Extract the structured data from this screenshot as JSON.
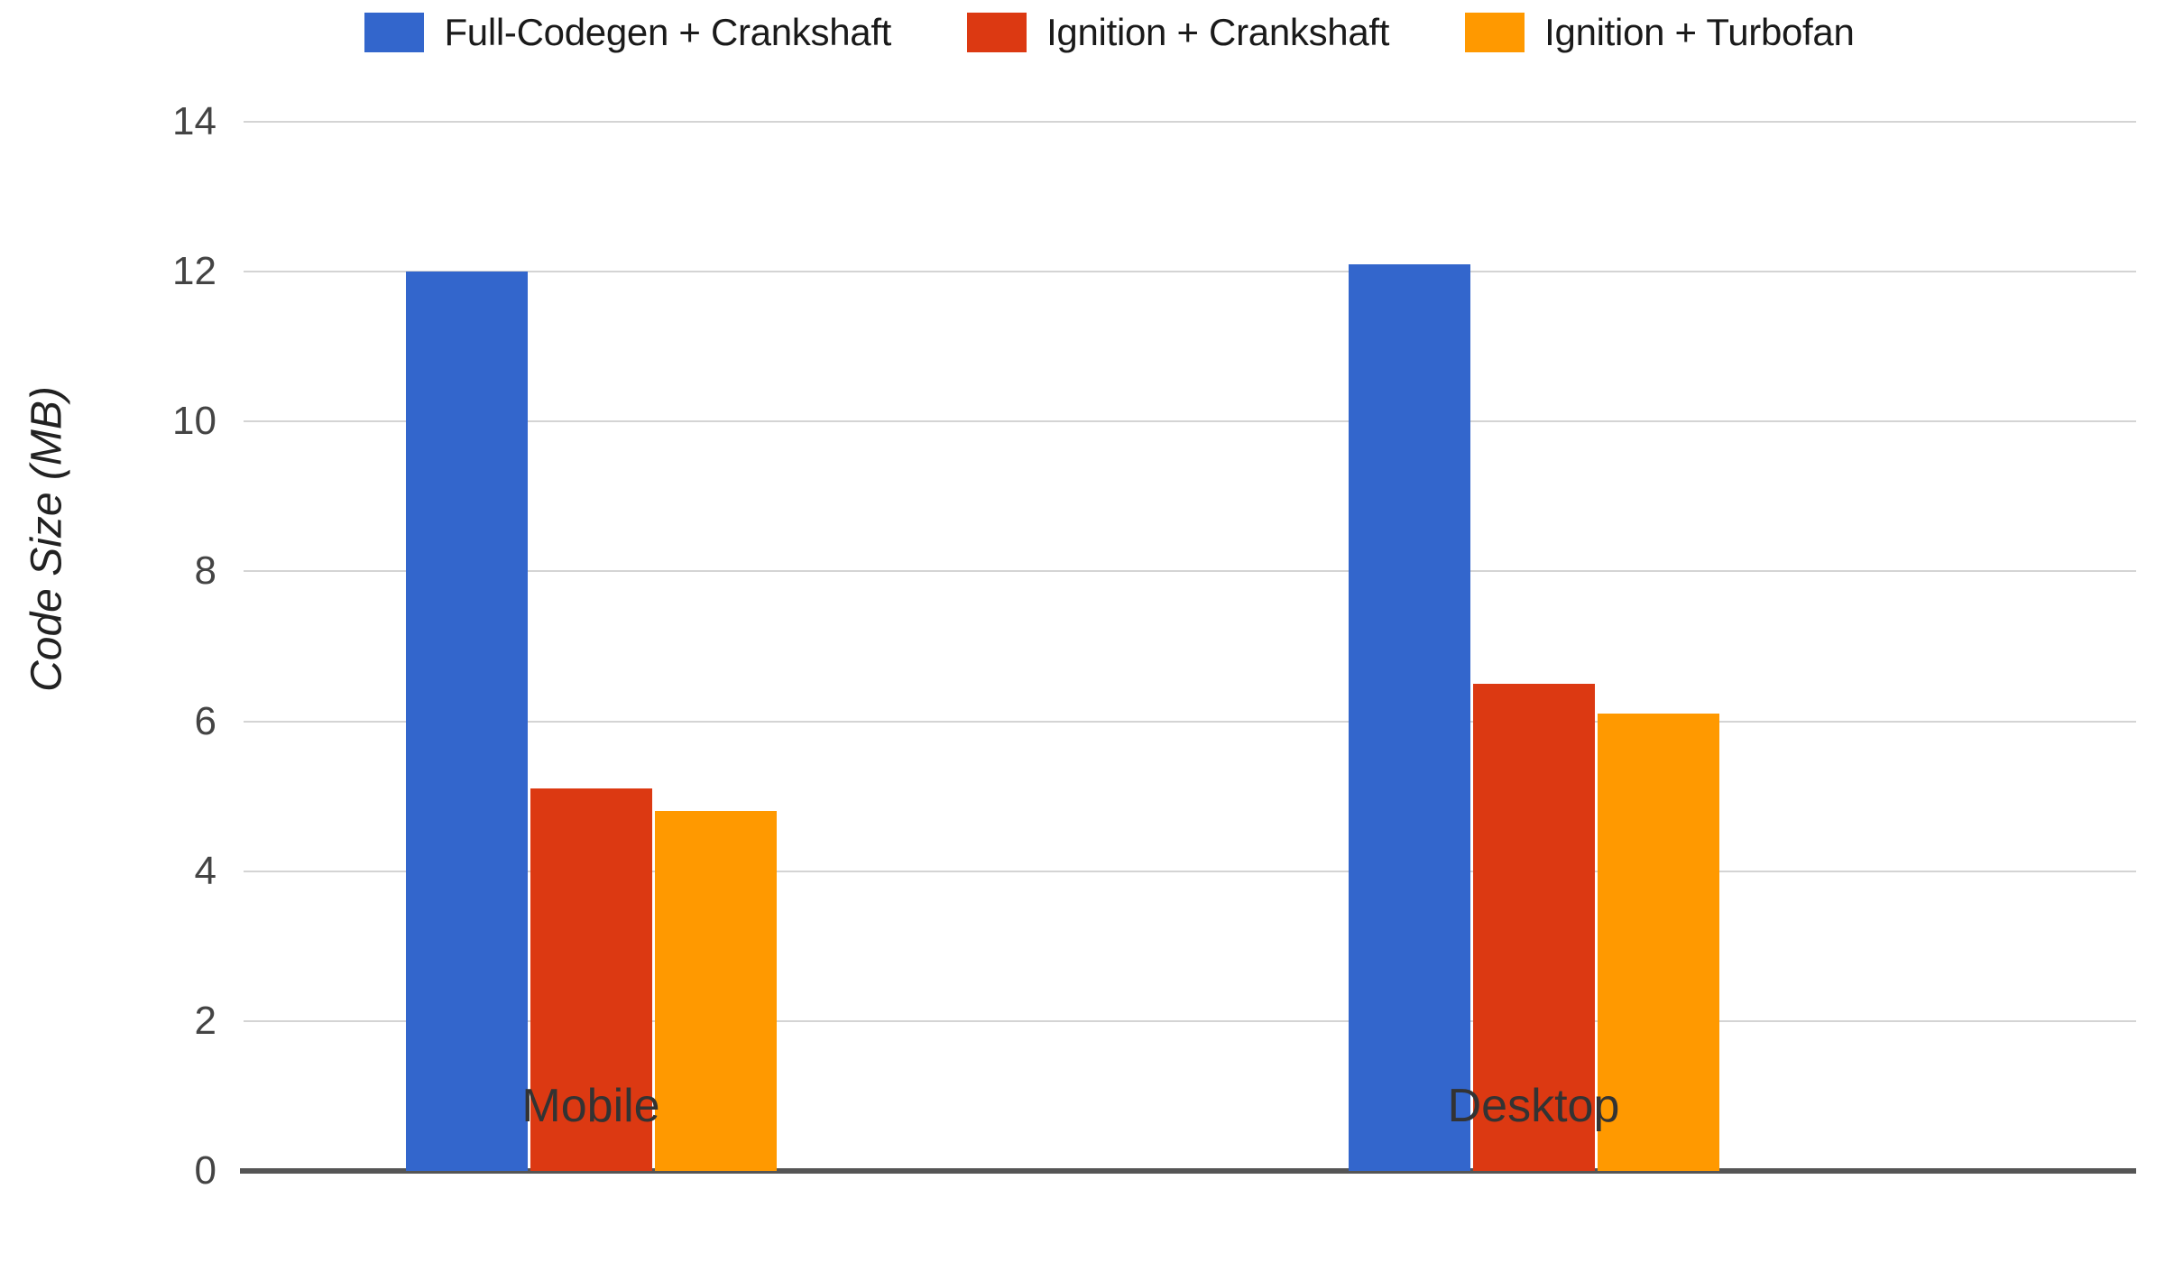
{
  "chart_data": {
    "type": "bar",
    "title": "",
    "subtitle": "",
    "xlabel": "",
    "ylabel": "Code Size (MB)",
    "categories": [
      "Mobile",
      "Desktop"
    ],
    "series": [
      {
        "name": "Full-Codegen + Crankshaft",
        "color": "#3366CC",
        "values": [
          12.0,
          12.1
        ]
      },
      {
        "name": "Ignition + Crankshaft",
        "color": "#DC3912",
        "values": [
          5.1,
          6.5
        ]
      },
      {
        "name": "Ignition + Turbofan",
        "color": "#FF9900",
        "values": [
          4.8,
          6.1
        ]
      }
    ],
    "ylim": [
      0,
      14
    ],
    "ytick_step": 2,
    "yticks": [
      "14",
      "12",
      "10",
      "8",
      "6",
      "4",
      "2",
      "0"
    ],
    "ytick_values": [
      14,
      12,
      10,
      8,
      6,
      4,
      2,
      0
    ],
    "grid": true,
    "grid_axis": "y",
    "legend_position": "top",
    "background_color": "#FFFFFF",
    "gridline_color": "#D4D4D4",
    "axis_color": "#555555"
  }
}
